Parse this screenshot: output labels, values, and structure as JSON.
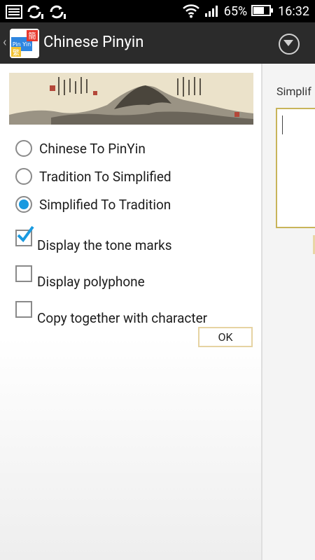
{
  "status_bar": {
    "battery": "65%",
    "time": "16:32",
    "icons": [
      "gallery-notification-icon",
      "sync-icon",
      "sync-icon",
      "wifi-icon",
      "signal-icon",
      "battery-icon"
    ]
  },
  "action_bar": {
    "title": "Chinese Pinyin",
    "icon_labels": {
      "top": "簡",
      "middle": "Pin Yin",
      "bottom": "繁"
    }
  },
  "options": {
    "radios": [
      {
        "label": "Chinese To PinYin",
        "checked": false
      },
      {
        "label": "Tradition To Simplified",
        "checked": false
      },
      {
        "label": "Simplified To Tradition",
        "checked": true
      }
    ],
    "checkboxes": [
      {
        "label": "Display the tone marks",
        "checked": true
      },
      {
        "label": "Display polyphone",
        "checked": false
      },
      {
        "label": "Copy together with character",
        "checked": false
      }
    ],
    "ok_label": "OK"
  },
  "right_panel": {
    "label": "Simplif",
    "input_value": ""
  },
  "colors": {
    "radio_accent": "#1a9ae0",
    "action_bar": "#2b2b2b",
    "ok_border": "#e6d3a2"
  }
}
